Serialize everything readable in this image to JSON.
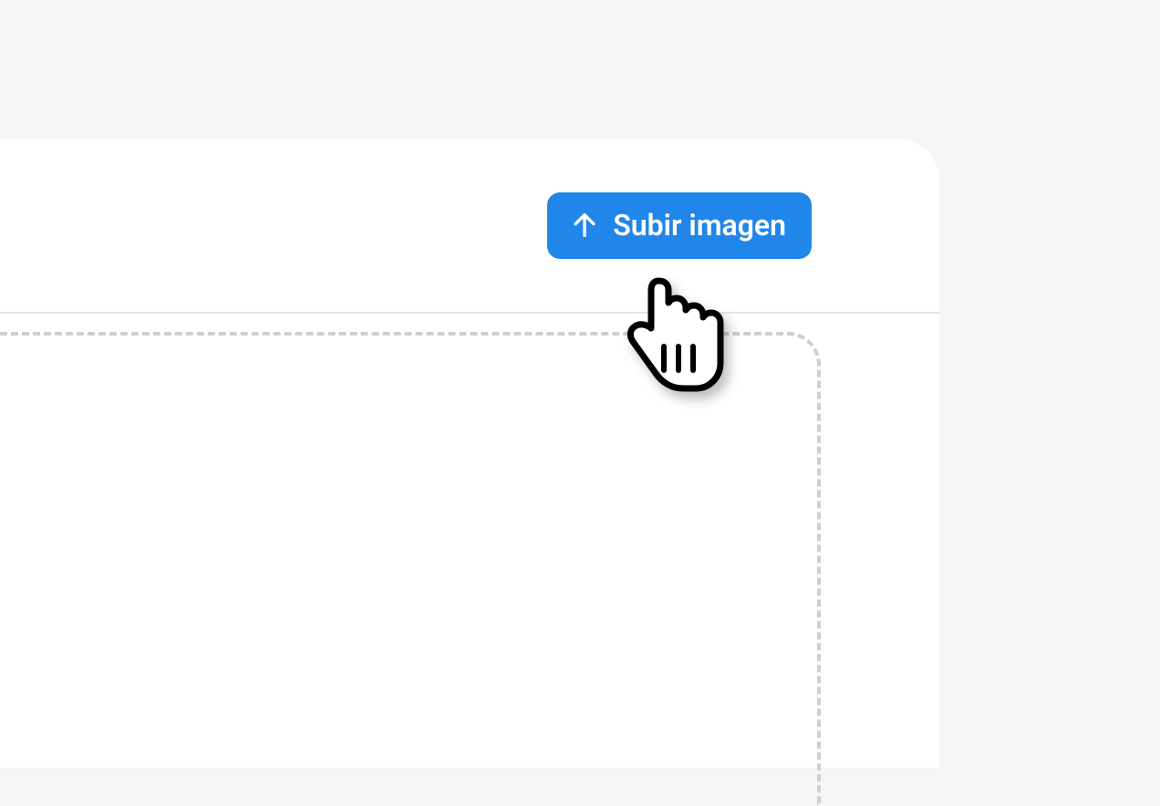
{
  "upload": {
    "button_label": "Subir imagen",
    "icon_name": "arrow-up-icon"
  },
  "colors": {
    "button_bg": "#2186e9",
    "button_text": "#ffffff"
  }
}
